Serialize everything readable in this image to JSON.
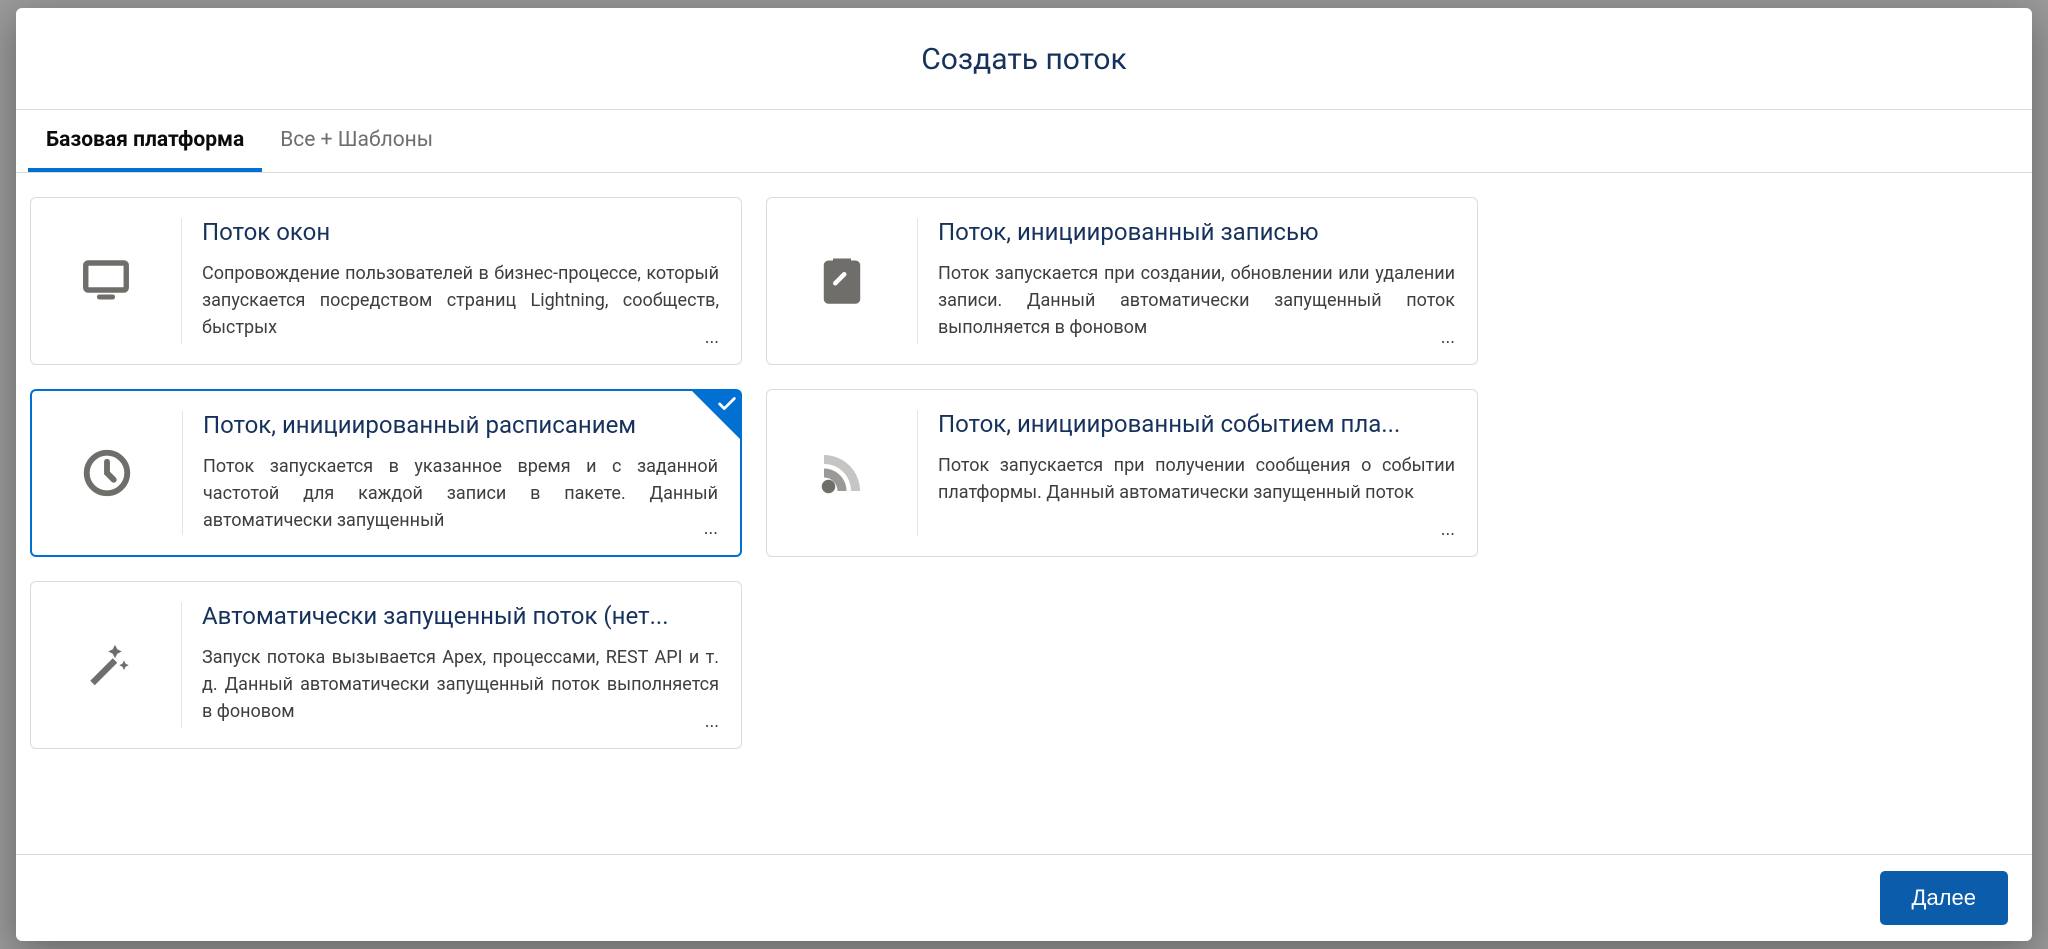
{
  "modal": {
    "title": "Создать поток",
    "tabs": [
      {
        "label": "Базовая платформа",
        "active": true
      },
      {
        "label": "Все + Шаблоны",
        "active": false
      }
    ],
    "cards": {
      "left": [
        {
          "icon": "desktop",
          "title": "Поток окон",
          "desc": "Сопровождение пользователей в бизнес-процессе, который запускается посредством страниц Lightning, сообществ, быстрых",
          "selected": false,
          "name": "card-screen-flow"
        },
        {
          "icon": "clock",
          "title": "Поток, инициированный расписанием",
          "desc": "Поток запускается в указанное время и с заданной частотой для каждой записи в пакете. Данный автоматически запущенный",
          "selected": true,
          "name": "card-schedule-flow"
        },
        {
          "icon": "wand",
          "title": "Автоматически запущенный поток (нет...",
          "desc": "Запуск потока вызывается Apex, процессами, REST API и т. д. Данный автоматически запущенный поток выполняется в фоновом",
          "selected": false,
          "name": "card-autolaunched-flow"
        }
      ],
      "right": [
        {
          "icon": "clipboard",
          "title": "Поток, инициированный записью",
          "desc": "Поток запускается при создании, обновлении или удалении записи. Данный автоматически запущенный поток выполняется в фоновом",
          "selected": false,
          "name": "card-record-flow"
        },
        {
          "icon": "signal",
          "title": "Поток, инициированный событием пла...",
          "desc": "Поток запускается при получении сообщения о событии платформы. Данный автоматически запущенный поток",
          "selected": false,
          "name": "card-platform-event-flow"
        }
      ]
    },
    "footer": {
      "next": "Далее"
    }
  }
}
